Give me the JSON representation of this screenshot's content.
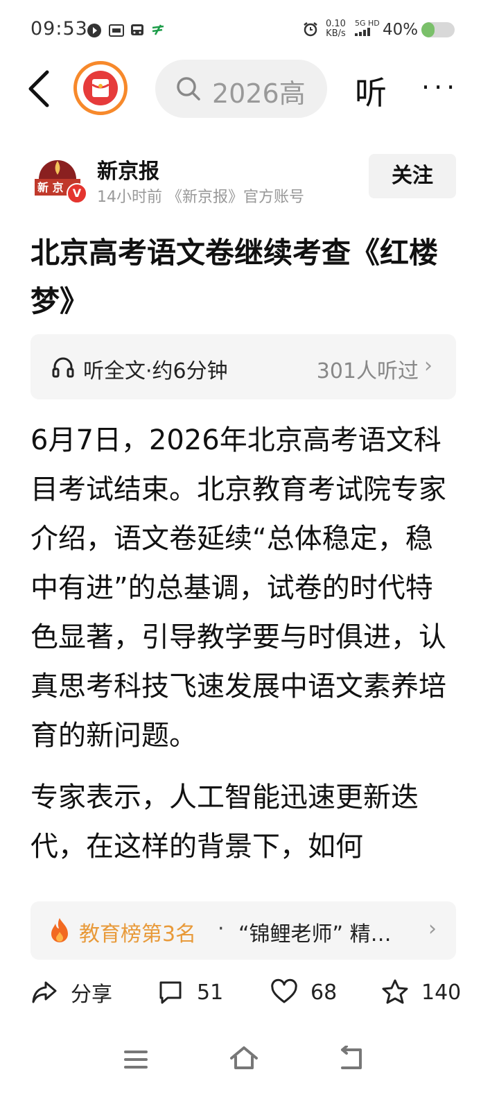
{
  "status": {
    "time": "09:53",
    "speed_value": "0.10",
    "speed_unit": "KB/s",
    "network_top": "5G HD",
    "battery_text": "40%",
    "battery_level": 0.4
  },
  "nav": {
    "search_text": "2026高",
    "listen_label": "听",
    "more_label": "···"
  },
  "author": {
    "name": "新京报",
    "meta": "14小时前 《新京报》官方账号",
    "follow_label": "关注",
    "verified_mark": "V"
  },
  "article": {
    "title": "北京高考语文卷继续考查《红楼梦》",
    "listen_label": "听全文·约6分钟",
    "listen_count": "301人听过",
    "paragraphs": [
      "6月7日，2026年北京高考语文科目考试结束。北京教育考试院专家介绍，语文卷延续“总体稳定，稳中有进”的总基调，试卷的时代特色显著，引导教学要与时俱进，认真思考科技飞速发展中语文素养培育的新问题。",
      "专家表示，人工智能迅速更新迭代，在这样的背景下，如何"
    ]
  },
  "ranking": {
    "label": "教育榜第3名",
    "separator": "·",
    "text": "“锦鲤老师” 精…"
  },
  "actions": {
    "share_label": "分享",
    "comment_count": "51",
    "like_count": "68",
    "favorite_count": "140"
  },
  "colors": {
    "accent_orange": "#f7892b",
    "rank_orange": "#e89a3a",
    "battery_green": "#7ac06a",
    "verify_red": "#e4352f"
  }
}
